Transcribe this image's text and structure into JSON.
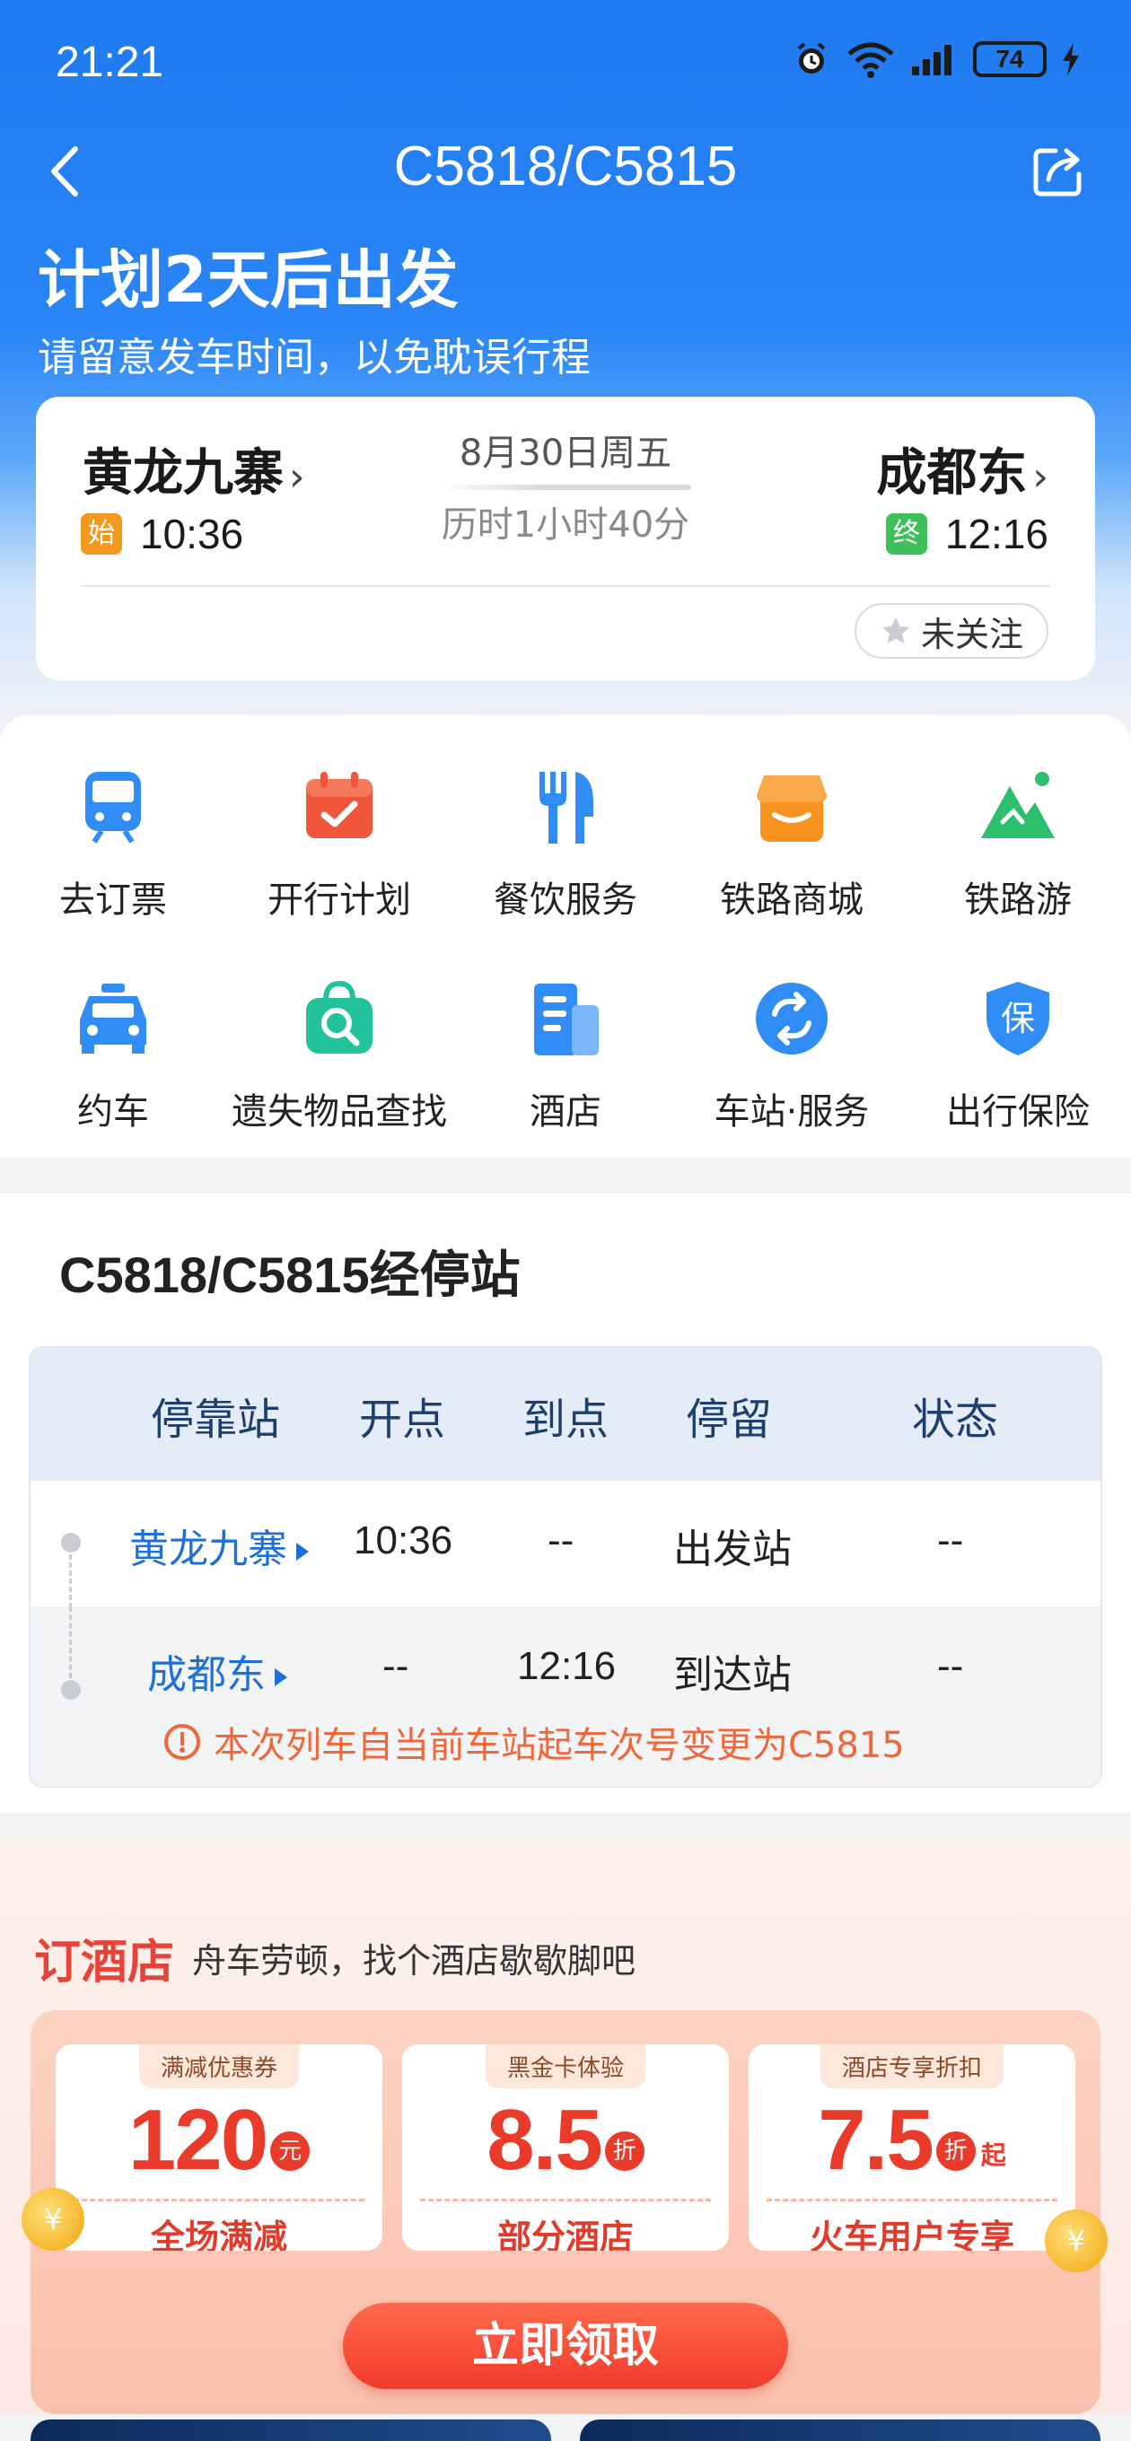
{
  "status_bar": {
    "time": "21:21",
    "battery": "74"
  },
  "nav": {
    "title": "C5818/C5815"
  },
  "plan": {
    "title": "计划2天后出发",
    "subtitle": "请留意发车时间，以免耽误行程"
  },
  "trip": {
    "from_station": "黄龙九寨",
    "from_badge": "始",
    "from_time": "10:36",
    "to_station": "成都东",
    "to_badge": "终",
    "to_time": "12:16",
    "date": "8月30日周五",
    "duration": "历时1小时40分",
    "follow_label": "未关注"
  },
  "services": [
    {
      "label": "去订票",
      "icon": "train-ticket-icon"
    },
    {
      "label": "开行计划",
      "icon": "calendar-icon"
    },
    {
      "label": "餐饮服务",
      "icon": "fork-knife-icon"
    },
    {
      "label": "铁路商城",
      "icon": "shop-icon"
    },
    {
      "label": "铁路游",
      "icon": "mountain-icon"
    },
    {
      "label": "约车",
      "icon": "car-icon"
    },
    {
      "label": "遗失物品查找",
      "icon": "lost-bag-icon"
    },
    {
      "label": "酒店",
      "icon": "hotel-building-icon"
    },
    {
      "label": "车站·服务",
      "icon": "station-service-icon"
    },
    {
      "label": "出行保险",
      "icon": "insurance-shield-icon"
    }
  ],
  "stops": {
    "title": "C5818/C5815经停站",
    "headers": [
      "停靠站",
      "开点",
      "到点",
      "停留",
      "状态"
    ],
    "rows": [
      {
        "station": "黄龙九寨",
        "depart": "10:36",
        "arrive": "--",
        "stay": "出发站",
        "status": "--"
      },
      {
        "station": "成都东",
        "depart": "--",
        "arrive": "12:16",
        "stay": "到达站",
        "status": "--"
      }
    ],
    "notice": "本次列车自当前车站起车次号变更为C5815"
  },
  "hotel": {
    "title": "订酒店",
    "subtitle": "舟车劳顿，找个酒店歇歇脚吧",
    "coupons": [
      {
        "tag": "满减优惠券",
        "value": "120",
        "unit": "元",
        "suffix": "",
        "desc": "全场满减"
      },
      {
        "tag": "黑金卡体验",
        "value": "8.5",
        "unit": "折",
        "suffix": "",
        "desc": "部分酒店"
      },
      {
        "tag": "酒店专享折扣",
        "value": "7.5",
        "unit": "折",
        "suffix": "起",
        "desc": "火车用户专享"
      }
    ],
    "claim_label": "立即领取"
  },
  "colors": {
    "brand_blue": "#1f7af0",
    "accent_red": "#ea3b2a",
    "start_badge": "#f39a1e",
    "end_badge": "#3fbf5a"
  }
}
